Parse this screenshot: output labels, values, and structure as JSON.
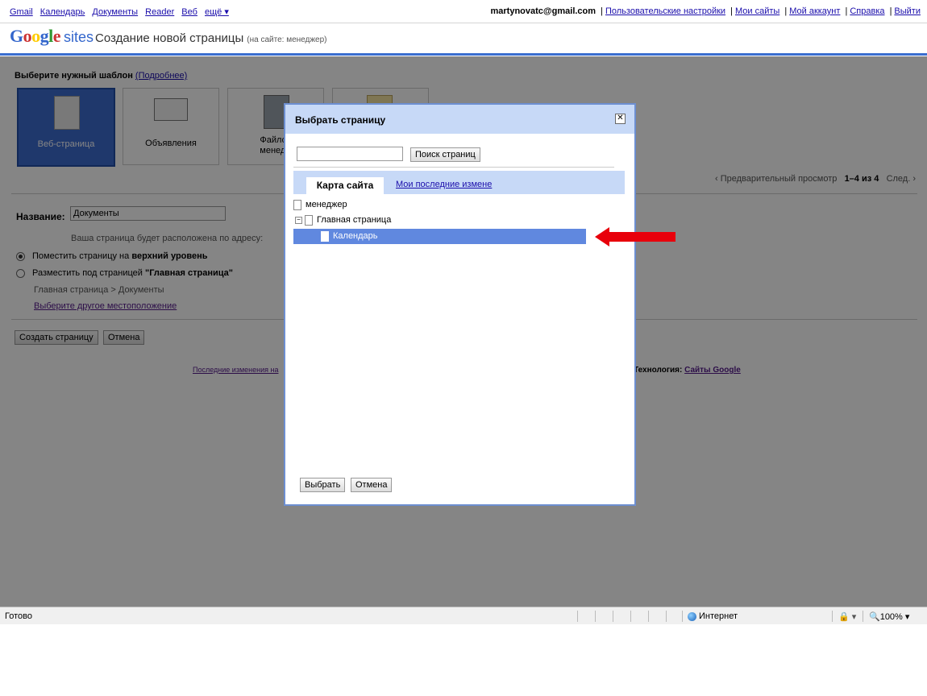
{
  "header": {
    "links": [
      "Gmail",
      "Календарь",
      "Документы",
      "Reader",
      "Веб",
      "ещё ▾"
    ],
    "user_email": "martynovatc@gmail.com",
    "right_links": [
      "Пользовательские настройки",
      "Мои сайты",
      "Мой аккаунт",
      "Справка",
      "Выйти"
    ]
  },
  "brand": {
    "google_letters": [
      "G",
      "o",
      "o",
      "g",
      "l",
      "e"
    ],
    "sites": "sites",
    "page_title": "Создание новой страницы",
    "page_subtitle": "(на сайте: менеджер)"
  },
  "templates": {
    "heading": "Выберите нужный шаблон",
    "more_link": "(Подробнее)",
    "items": [
      {
        "label": "Веб-страница",
        "selected": true,
        "icon": "page-icon"
      },
      {
        "label": "Объявления",
        "selected": false,
        "icon": "announcement-icon"
      },
      {
        "label": "Файлов",
        "label2": "менедж",
        "selected": false,
        "icon": "file-cabinet-icon"
      }
    ]
  },
  "pager": {
    "prev": "‹ Предварительный просмотр",
    "range": "1–4 из 4",
    "next": "След. ›"
  },
  "form": {
    "name_label": "Название:",
    "name_value": "Документы",
    "address_text": "Ваша страница будет расположена по адресу:",
    "radio_top_prefix": "Поместить страницу на",
    "radio_top_bold": "верхний уровень",
    "radio_under_prefix": "Разместить под страницей",
    "radio_under_bold": "\"Главная страница\"",
    "crumb": "Главная страница > Документы",
    "other_location": "Выберите другое местоположение",
    "create_button": "Создать страницу",
    "cancel_button": "Отмена"
  },
  "footer": {
    "left": "Последние изменения на",
    "tech_label": "Технология:",
    "tech_link": "Сайты Google"
  },
  "dialog": {
    "title": "Выбрать страницу",
    "search_value": "",
    "search_button": "Поиск страниц",
    "tabs": [
      "Карта сайта",
      "Мои последние измене"
    ],
    "tree": [
      {
        "label": "менеджер",
        "level": 0,
        "selected": false
      },
      {
        "label": "Главная страница",
        "level": 0,
        "expanded": true,
        "selected": false
      },
      {
        "label": "Календарь",
        "level": 1,
        "selected": true
      }
    ],
    "ok_button": "Выбрать",
    "cancel_button": "Отмена"
  },
  "statusbar": {
    "text": "Готово",
    "zone": "Интернет",
    "security": "🔒 ▾",
    "zoom": "🔍100%  ▾"
  },
  "colors": {
    "accent_blue": "#3a6ecf",
    "selected_template": "#3d6cd0",
    "dialog_header": "#c7d9f7",
    "tree_selected": "#6088df",
    "annotation_arrow": "#e8000b"
  }
}
